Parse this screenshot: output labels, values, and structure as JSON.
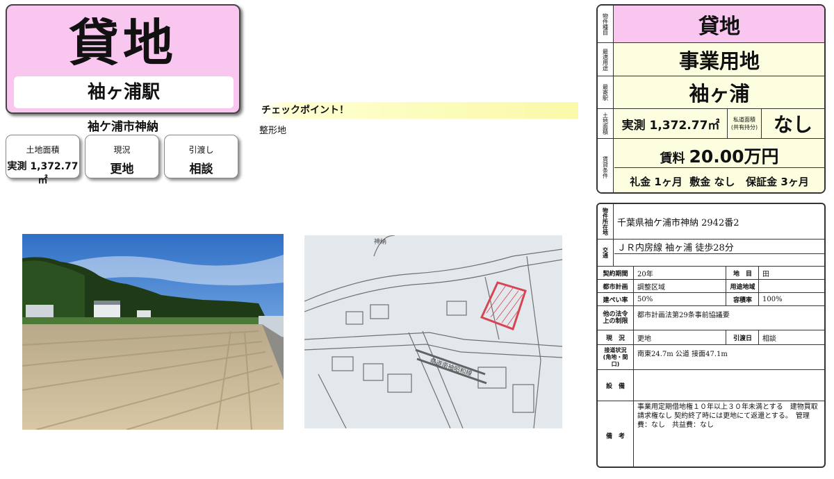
{
  "header": {
    "title": "貸地",
    "station": "袖ヶ浦駅",
    "address_short": "袖ケ浦市神納"
  },
  "info_boxes": [
    {
      "label": "土地面積",
      "value": "実測 1,372.77㎡"
    },
    {
      "label": "現況",
      "value": "更地"
    },
    {
      "label": "引渡し",
      "value": "相談"
    }
  ],
  "checkpoint": {
    "heading": "チェックポイント！",
    "text": "整形地"
  },
  "spec": {
    "type_label": "物件種目",
    "type_value": "貸地",
    "use_label": "最適用途",
    "use_value": "事業用地",
    "station_label": "最寄駅",
    "station_value": "袖ヶ浦",
    "area_label": "土地面積",
    "area_value": "実測 1,372.77㎡",
    "private_road_label": "私道面積",
    "private_road_sub": "(共有持分)",
    "private_road_value": "なし",
    "lease_label": "賃貸条件",
    "rent_prefix": "賃料",
    "rent_value": "20.00万円",
    "terms": "礼金 1ヶ月  敷金 なし   保証金 3ヶ月"
  },
  "detail": {
    "location_label": "物件所在地",
    "location_value": "千葉県袖ケ浦市神納 2942番2",
    "transport_label": "交通",
    "transport_value": "ＪＲ内房線 袖ヶ浦 徒歩28分",
    "contract_label": "契約期間",
    "contract_value": "20年",
    "land_cat_label": "地　目",
    "land_cat_value": "田",
    "city_plan_label": "都市計画",
    "city_plan_value": "調整区域",
    "zoning_label": "用途地域",
    "zoning_value": "",
    "bcr_label": "建ぺい率",
    "bcr_value": "50%",
    "far_label": "容積率",
    "far_value": "100%",
    "law_label": "他の法令上の制限",
    "law_value": "都市計画法第29条事前協議要",
    "status_label": "現　況",
    "status_value": "更地",
    "handover_label": "引渡日",
    "handover_value": "相談",
    "road_label": "接道状況(角地・間口)",
    "road_value": "南東24.7m 公道 接面47.1m",
    "facility_label": "設　備",
    "facility_value": "",
    "remarks_label": "備　考",
    "remarks_value": "事業用定期借地権１０年以上３０年未満とする　建物買取請求権なし 契約終了時には更地にて返還とする。　管理費：なし　共益費：なし"
  },
  "map": {
    "road_label": "県道南袖昭和線",
    "place_label": "神納"
  }
}
